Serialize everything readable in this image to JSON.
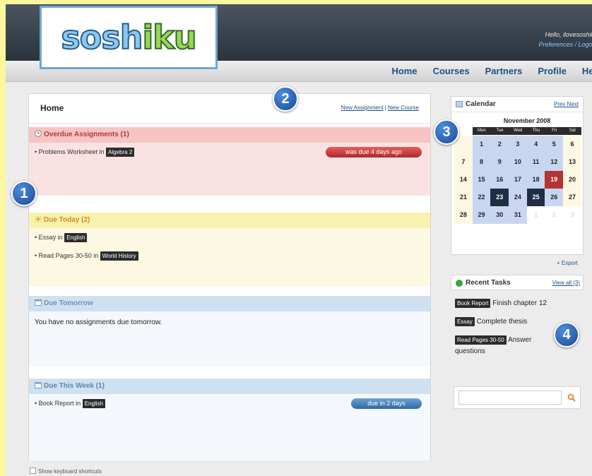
{
  "header": {
    "logo": "soshiku",
    "greeting": "Hello, ilovesoshiku",
    "links": "Preferences / Logout"
  },
  "nav": [
    "Home",
    "Courses",
    "Partners",
    "Profile",
    "Help"
  ],
  "main": {
    "title": "Home",
    "new_assignment": "New Assignment",
    "separator": "|",
    "new_course": "New Course",
    "overdue": {
      "heading": "Overdue Assignments (1)",
      "item_text": "Problems Worksheet in",
      "item_tag": "Algebra 2",
      "item_status": "was due 4 days ago"
    },
    "today": {
      "heading": "Due Today (2)",
      "items": [
        {
          "text": "Essay in",
          "tag": "English"
        },
        {
          "text": "Read Pages 30-50 in",
          "tag": "World History"
        }
      ]
    },
    "tomorrow": {
      "heading": "Due Tomorrow",
      "message": "You have no assignments due tomorrow."
    },
    "week": {
      "heading": "Due This Week (1)",
      "item_text": "Book Report in",
      "item_tag": "English",
      "item_status": "due in 2 days"
    }
  },
  "keyboard_shortcuts": "Show keyboard shortcuts",
  "calendar": {
    "title": "Calendar",
    "nav": "Prev Next",
    "month": "November 2008",
    "weekdays": [
      "Mon",
      "Tue",
      "Wed",
      "Thu",
      "Fri",
      "Sat"
    ],
    "days": [
      "",
      "1",
      "2",
      "3",
      "4",
      "5",
      "6",
      "7",
      "8",
      "9",
      "10",
      "11",
      "12",
      "13",
      "14",
      "15",
      "16",
      "17",
      "18",
      "19",
      "20",
      "21",
      "22",
      "23",
      "24",
      "25",
      "26",
      "27",
      "28",
      "29",
      "30",
      "31",
      "1",
      "2",
      "3"
    ],
    "export": "+ Export"
  },
  "recent": {
    "title": "Recent Tasks",
    "view_all": "View all (3)",
    "tasks": [
      {
        "tag": "Book Report",
        "text": "Finish chapter 12"
      },
      {
        "tag": "Essay",
        "text": "Complete thesis"
      },
      {
        "tag": "Read Pages 30-50",
        "text": "Answer questions"
      }
    ]
  },
  "search": {
    "placeholder": ""
  },
  "badges": [
    "1",
    "2",
    "3",
    "4"
  ],
  "colors": {
    "overdue": "#b03a3a",
    "today": "#d88a18",
    "upcoming": "#5c85b0",
    "nav_link": "#1d4f88"
  }
}
